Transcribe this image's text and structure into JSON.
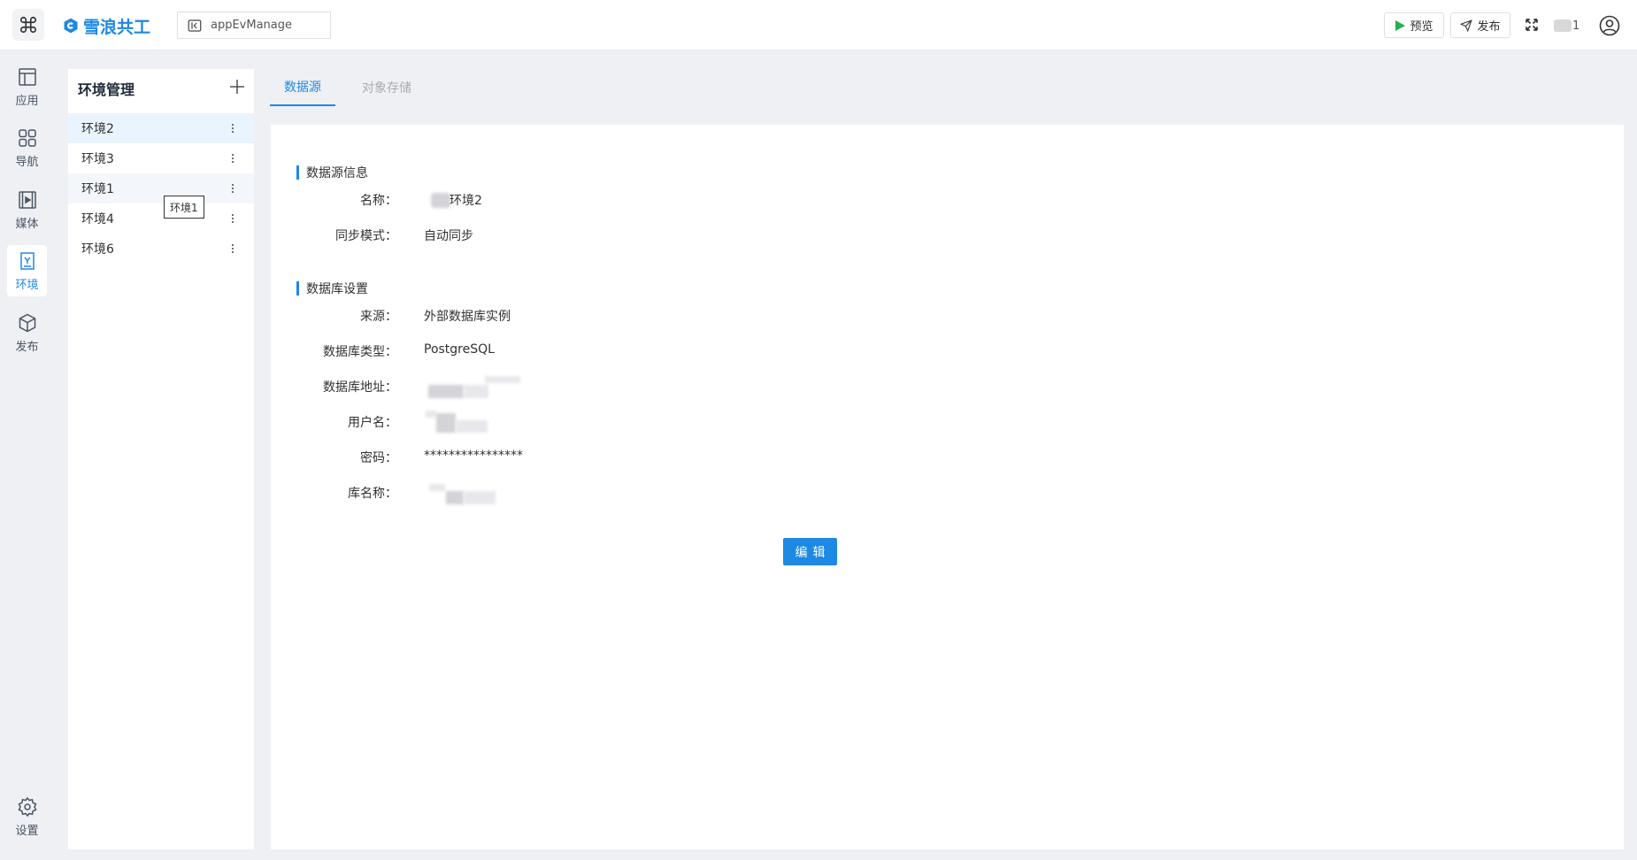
{
  "header": {
    "brand_name": "雪浪共工",
    "project_name": "appEvManage",
    "preview_label": "预览",
    "publish_label": "发布",
    "user_name_suffix": "1"
  },
  "rail": {
    "items": [
      {
        "label": "应用",
        "icon": "layout-icon"
      },
      {
        "label": "导航",
        "icon": "grid-icon"
      },
      {
        "label": "媒体",
        "icon": "media-icon"
      },
      {
        "label": "环境",
        "icon": "environment-icon",
        "active": true
      },
      {
        "label": "发布",
        "icon": "package-icon"
      }
    ],
    "settings_label": "设置"
  },
  "env_panel": {
    "title": "环境管理",
    "items": [
      {
        "label": "环境2",
        "state": "active"
      },
      {
        "label": "环境3"
      },
      {
        "label": "环境1",
        "state": "hover"
      },
      {
        "label": "环境4"
      },
      {
        "label": "环境6"
      }
    ],
    "tooltip": "环境1"
  },
  "tabs": [
    {
      "label": "数据源",
      "active": true
    },
    {
      "label": "对象存储"
    }
  ],
  "datasource": {
    "section1_title": "数据源信息",
    "name_label": "名称：",
    "name_value_suffix": "环境2",
    "sync_label": "同步模式：",
    "sync_value": "自动同步",
    "section2_title": "数据库设置",
    "source_label": "来源：",
    "source_value": "外部数据库实例",
    "db_type_label": "数据库类型：",
    "db_type_value": "PostgreSQL",
    "db_addr_label": "数据库地址：",
    "username_label": "用户名：",
    "password_label": "密码：",
    "password_value": "****************",
    "db_name_label": "库名称：",
    "edit_label": "编辑"
  },
  "colors": {
    "accent": "#1e88e5",
    "active_bg": "#eaf4ff",
    "page_bg": "#eef0f4"
  }
}
